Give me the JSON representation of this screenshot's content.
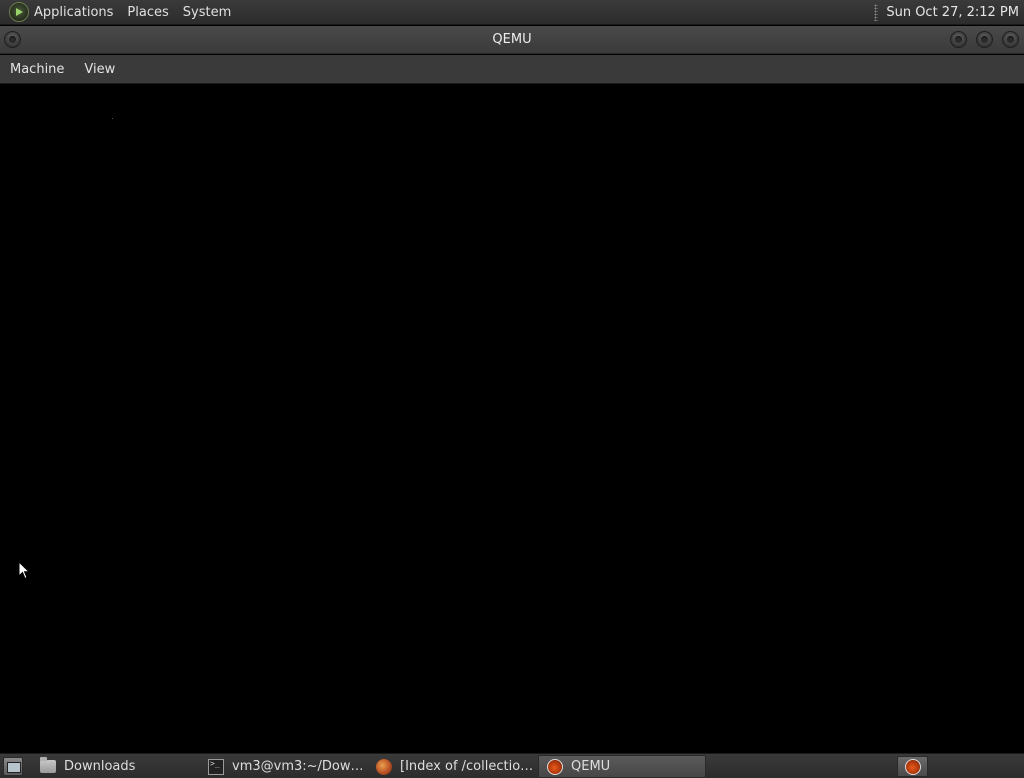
{
  "top_panel": {
    "menus": [
      "Applications",
      "Places",
      "System"
    ],
    "clock": "Sun Oct 27,  2:12 PM"
  },
  "window": {
    "title": "QEMU",
    "menus": [
      "Machine",
      "View"
    ]
  },
  "taskbar": {
    "tasks": [
      {
        "label": "Downloads",
        "icon": "folder-icon"
      },
      {
        "label": "vm3@vm3:~/Downl...",
        "icon": "terminal-icon"
      },
      {
        "label": "[Index of /collection...",
        "icon": "firefox-icon"
      },
      {
        "label": "QEMU",
        "icon": "qemu-icon",
        "active": true
      }
    ]
  },
  "colors": {
    "panel_bg": "#2c2c2c",
    "vm_screen": "#000000",
    "text": "#e0e0e0"
  }
}
